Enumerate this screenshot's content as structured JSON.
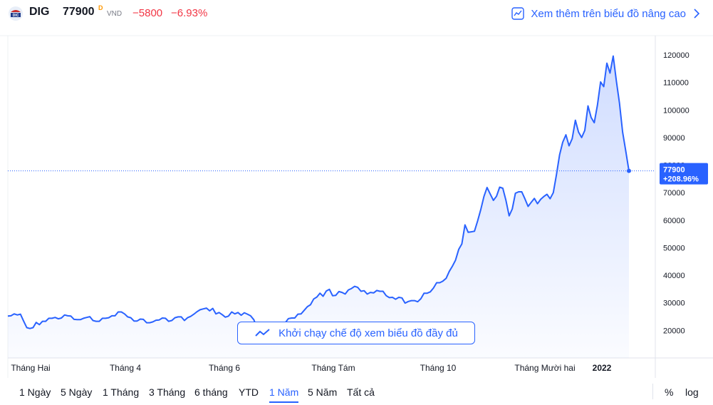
{
  "header": {
    "symbol": "DIG",
    "price": "77900",
    "price_flag": "D",
    "currency": "VND",
    "change": "−5800",
    "change_percent": "−6.93%",
    "advanced_link": "Xem thêm trên biểu đồ nâng cao",
    "logo_icon": "dic-logo-icon"
  },
  "launch_button": "Khởi chạy chế độ xem biểu đồ đầy đủ",
  "ranges": [
    "1 Ngày",
    "5 Ngày",
    "1 Tháng",
    "3 Tháng",
    "6 tháng",
    "YTD",
    "1 Năm",
    "5 Năm",
    "Tất cả"
  ],
  "active_range": "1 Năm",
  "scale": {
    "percent": "%",
    "log": "log"
  },
  "colors": {
    "line": "#2962ff",
    "down": "#f23645",
    "accent": "#2962ff"
  },
  "chart_data": {
    "type": "area",
    "title": "",
    "xlabel": "",
    "ylabel": "",
    "x_ticks": [
      "Tháng Hai",
      "Tháng 4",
      "Tháng 6",
      "Tháng Tám",
      "Tháng 10",
      "Tháng Mười hai",
      "2022"
    ],
    "y_ticks": [
      "20000",
      "30000",
      "40000",
      "50000",
      "60000",
      "70000",
      "80000",
      "90000",
      "100000",
      "110000",
      "120000"
    ],
    "ylim": [
      10000,
      127000
    ],
    "last_value_label": "77900",
    "last_change_label": "+208.96%",
    "grid": false,
    "series": [
      {
        "values": [
          25200,
          25300,
          26000,
          25600,
          25900,
          23400,
          21000,
          20700,
          21000,
          22900,
          22100,
          23300,
          23300,
          24400,
          24400,
          24700,
          24200,
          24500,
          25600,
          25300,
          25200,
          24000,
          23900,
          23900,
          24400,
          24700,
          25000,
          23600,
          23300,
          23300,
          24400,
          24400,
          24600,
          25300,
          25300,
          26700,
          26700,
          26000,
          24900,
          24600,
          23400,
          23400,
          24100,
          24000,
          22800,
          22800,
          23100,
          23700,
          23800,
          24500,
          24400,
          23300,
          23600,
          24600,
          24900,
          24900,
          23600,
          24600,
          25100,
          25900,
          26800,
          27500,
          27800,
          28100,
          27100,
          28000,
          26000,
          26500,
          25700,
          24800,
          25200,
          26700,
          26000,
          26500,
          25500,
          26400,
          25900,
          25300,
          23900,
          21100,
          20600,
          20300,
          20800,
          20700,
          20400,
          20700,
          21600,
          22800,
          22800,
          24300,
          24500,
          24500,
          25900,
          26000,
          27300,
          28600,
          29300,
          31400,
          32100,
          33500,
          32400,
          34300,
          34900,
          32600,
          32700,
          34100,
          33800,
          33200,
          34700,
          35200,
          36000,
          35600,
          34200,
          34400,
          33200,
          33800,
          33600,
          34500,
          34200,
          34200,
          32600,
          31900,
          32000,
          31300,
          32000,
          31800,
          29900,
          30500,
          30800,
          30800,
          30400,
          31500,
          33500,
          33500,
          34000,
          35400,
          37300,
          37300,
          37900,
          38900,
          41400,
          43300,
          45500,
          49400,
          51400,
          58300,
          55600,
          55800,
          56000,
          59700,
          63900,
          68600,
          71900,
          69500,
          67200,
          68700,
          72000,
          71600,
          67100,
          61600,
          64100,
          69800,
          70300,
          70300,
          67800,
          65000,
          66500,
          67900,
          66000,
          67600,
          68600,
          69400,
          67800,
          70000,
          76500,
          83700,
          88300,
          91000,
          87000,
          89600,
          96300,
          92000,
          90000,
          92600,
          101500,
          97300,
          95400,
          101700,
          110200,
          108500,
          117000,
          113400,
          119600,
          110600,
          102500,
          92000,
          85000,
          77900
        ]
      }
    ]
  }
}
